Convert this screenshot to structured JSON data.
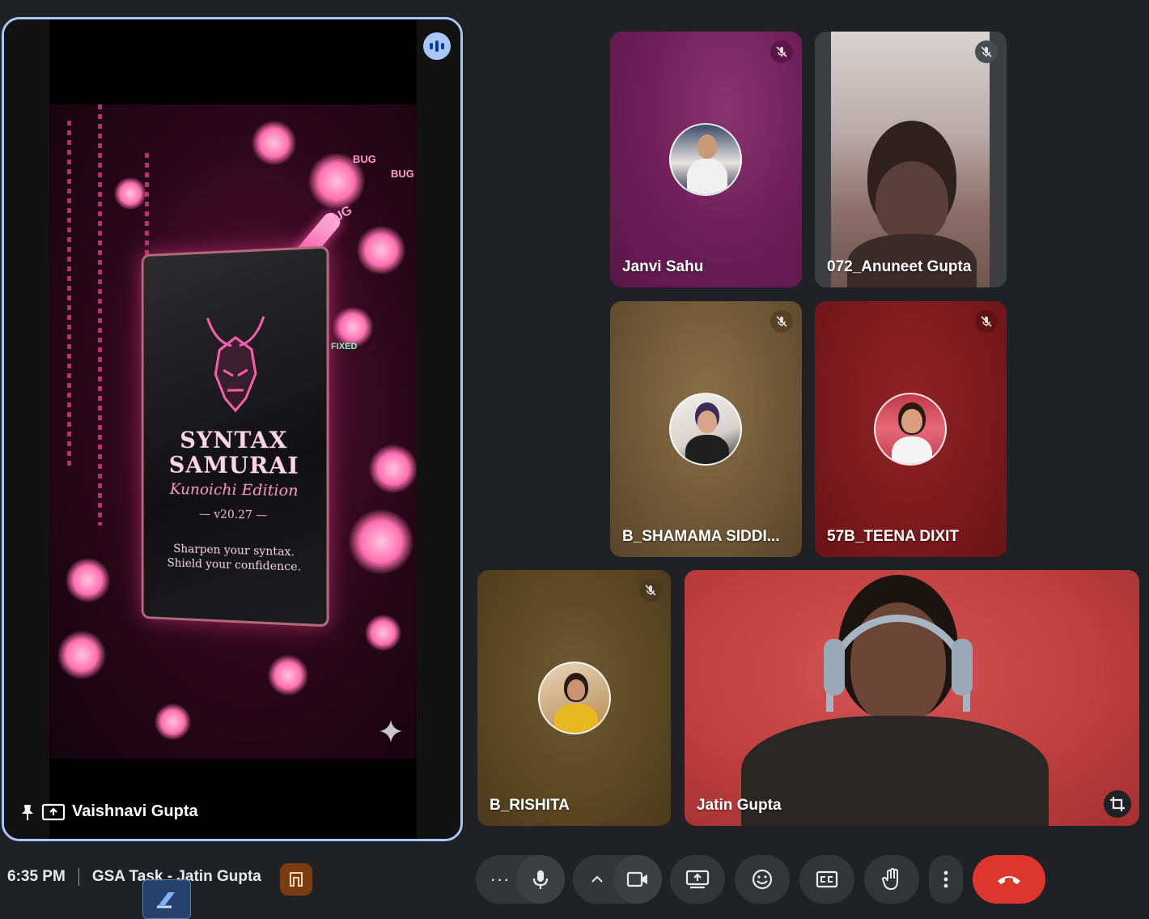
{
  "presenter": {
    "name": "Vaishnavi Gupta",
    "slide": {
      "title_line1": "SYNTAX",
      "title_line2": "SAMURAI",
      "edition": "Kunoichi Edition",
      "version": "— v20.27 —",
      "tagline1": "Sharpen your syntax.",
      "tagline2": "Shield your confidence.",
      "bug_labels": [
        "BUG",
        "BUG",
        "BUG"
      ],
      "fixed_label": "FIXED"
    }
  },
  "participants": {
    "janvi": {
      "name": "Janvi Sahu",
      "muted": true,
      "accent": "#7a1f63"
    },
    "anuneet": {
      "name": "072_Anuneet Gupta",
      "muted": true,
      "accent": "#3c4043"
    },
    "shamama": {
      "name": "B_SHAMAMA SIDDI...",
      "muted": true,
      "accent": "#6d5636"
    },
    "teena": {
      "name": "57B_TEENA DIXIT",
      "muted": true,
      "accent": "#7a191d"
    },
    "rishita": {
      "name": "B_RISHITA",
      "muted": true,
      "accent": "#5a4622"
    },
    "jatin": {
      "name": "Jatin Gupta",
      "muted": false,
      "accent": "#c24242"
    }
  },
  "meeting": {
    "time": "6:35 PM",
    "title": "GSA Task - Jatin Gupta"
  },
  "controls": {
    "icons": [
      "more-options-icon",
      "microphone-icon",
      "chevron-up-icon",
      "camera-icon",
      "present-screen-icon",
      "emoji-icon",
      "captions-icon",
      "raise-hand-icon",
      "more-vert-icon",
      "end-call-icon"
    ],
    "end_call_color": "#dc362e",
    "accent_color": "#a8c7fa"
  }
}
